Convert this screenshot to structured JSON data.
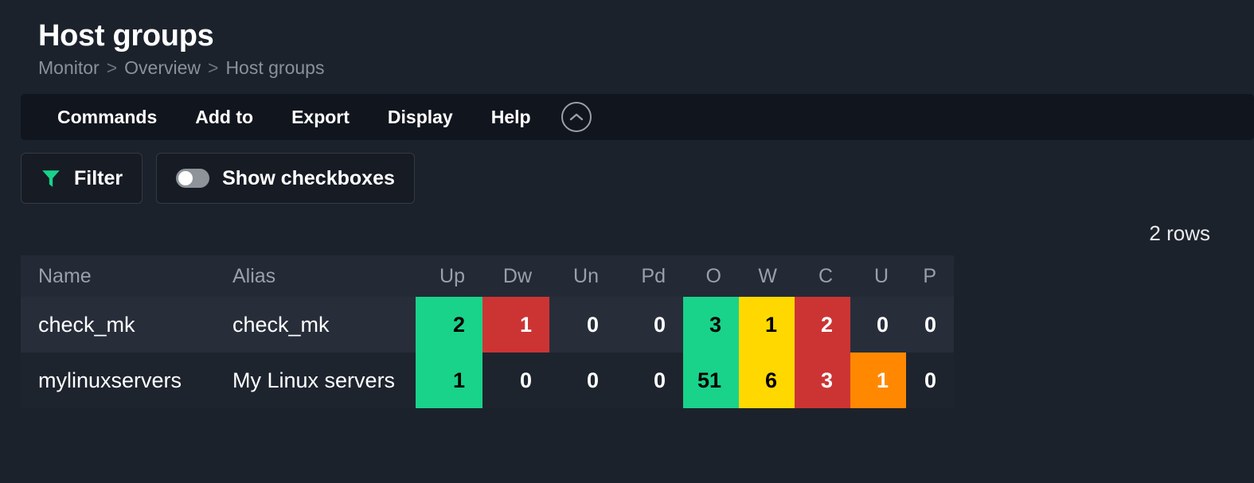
{
  "page": {
    "title": "Host groups",
    "breadcrumb": [
      "Monitor",
      "Overview",
      "Host groups"
    ],
    "breadcrumb_separator": ">"
  },
  "menubar": {
    "items": [
      {
        "label": "Commands"
      },
      {
        "label": "Add to"
      },
      {
        "label": "Export"
      },
      {
        "label": "Display"
      },
      {
        "label": "Help"
      }
    ],
    "collapse_icon": "chevron-up-circle-icon"
  },
  "toolbar": {
    "filter_label": "Filter",
    "filter_icon": "funnel-icon",
    "filter_icon_color": "#19d38a",
    "checkboxes_label": "Show checkboxes",
    "checkboxes_toggle_state": "off"
  },
  "table": {
    "row_count_text": "2 rows",
    "columns": [
      {
        "key": "name",
        "label": "Name",
        "align": "left"
      },
      {
        "key": "alias",
        "label": "Alias",
        "align": "left"
      },
      {
        "key": "up",
        "label": "Up",
        "align": "right"
      },
      {
        "key": "dw",
        "label": "Dw",
        "align": "right"
      },
      {
        "key": "un",
        "label": "Un",
        "align": "right"
      },
      {
        "key": "pd",
        "label": "Pd",
        "align": "right"
      },
      {
        "key": "o",
        "label": "O",
        "align": "right"
      },
      {
        "key": "w",
        "label": "W",
        "align": "right"
      },
      {
        "key": "c",
        "label": "C",
        "align": "right"
      },
      {
        "key": "u",
        "label": "U",
        "align": "right"
      },
      {
        "key": "p",
        "label": "P",
        "align": "right"
      }
    ],
    "rows": [
      {
        "name": "check_mk",
        "alias": "check_mk",
        "cells": [
          {
            "value": "2",
            "bg": "#19d38a",
            "fg": "#000000"
          },
          {
            "value": "1",
            "bg": "#cc3434",
            "fg": "#ffffff"
          },
          {
            "value": "0",
            "bg": "",
            "fg": "#ffffff"
          },
          {
            "value": "0",
            "bg": "",
            "fg": "#ffffff"
          },
          {
            "value": "3",
            "bg": "#19d38a",
            "fg": "#000000"
          },
          {
            "value": "1",
            "bg": "#ffd800",
            "fg": "#000000"
          },
          {
            "value": "2",
            "bg": "#cc3434",
            "fg": "#ffffff"
          },
          {
            "value": "0",
            "bg": "",
            "fg": "#ffffff"
          },
          {
            "value": "0",
            "bg": "",
            "fg": "#ffffff"
          }
        ]
      },
      {
        "name": "mylinuxservers",
        "alias": "My Linux servers",
        "cells": [
          {
            "value": "1",
            "bg": "#19d38a",
            "fg": "#000000"
          },
          {
            "value": "0",
            "bg": "",
            "fg": "#ffffff"
          },
          {
            "value": "0",
            "bg": "",
            "fg": "#ffffff"
          },
          {
            "value": "0",
            "bg": "",
            "fg": "#ffffff"
          },
          {
            "value": "51",
            "bg": "#19d38a",
            "fg": "#000000"
          },
          {
            "value": "6",
            "bg": "#ffd800",
            "fg": "#000000"
          },
          {
            "value": "3",
            "bg": "#cc3434",
            "fg": "#ffffff"
          },
          {
            "value": "1",
            "bg": "#ff8800",
            "fg": "#ffffff"
          },
          {
            "value": "0",
            "bg": "",
            "fg": "#ffffff"
          }
        ]
      }
    ]
  }
}
